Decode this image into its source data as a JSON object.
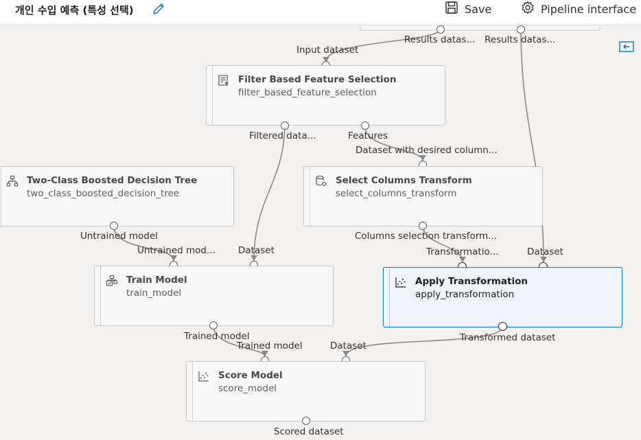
{
  "header": {
    "title": "개인 수입 예측 (특성 선택)",
    "save_label": "Save",
    "pipeline_label": "Pipeline interface"
  },
  "colors": {
    "accent": "#0078d4",
    "canvas": "#f3f2f1",
    "node_bg": "#f8f8f8",
    "wire": "#8a8886"
  },
  "nodes": [
    {
      "id": "filter",
      "title": "Filter Based Feature Selection",
      "subtitle": "filter_based_feature_selection",
      "icon": "filter-list-icon"
    },
    {
      "id": "boosted",
      "title": "Two-Class Boosted Decision Tree",
      "subtitle": "two_class_boosted_decision_tree",
      "icon": "tree-icon"
    },
    {
      "id": "selectcols",
      "title": "Select Columns Transform",
      "subtitle": "select_columns_transform",
      "icon": "database-gear-icon"
    },
    {
      "id": "train",
      "title": "Train Model",
      "subtitle": "train_model",
      "icon": "train-icon"
    },
    {
      "id": "apply",
      "title": "Apply Transformation",
      "subtitle": "apply_transformation",
      "icon": "scatter-icon"
    },
    {
      "id": "score",
      "title": "Score Model",
      "subtitle": "score_model",
      "icon": "scatter-icon"
    }
  ],
  "ports": {
    "results_dataset_1": "Results datas...",
    "results_dataset_2": "Results datas...",
    "input_dataset": "Input dataset",
    "filtered_dataset": "Filtered data...",
    "features": "Features",
    "dataset_desired_columns": "Dataset with desired column...",
    "untrained_model_out": "Untrained model",
    "untrained_model_in": "Untrained mod...",
    "train_dataset_in": "Dataset",
    "columns_selection_transform": "Columns selection transform...",
    "transformation_in": "Transformatio...",
    "apply_dataset_in": "Dataset",
    "trained_model_out": "Trained model",
    "trained_model_in": "Trained model",
    "score_dataset_in": "Dataset",
    "transformed_dataset": "Transformed dataset",
    "scored_dataset": "Scored dataset"
  }
}
